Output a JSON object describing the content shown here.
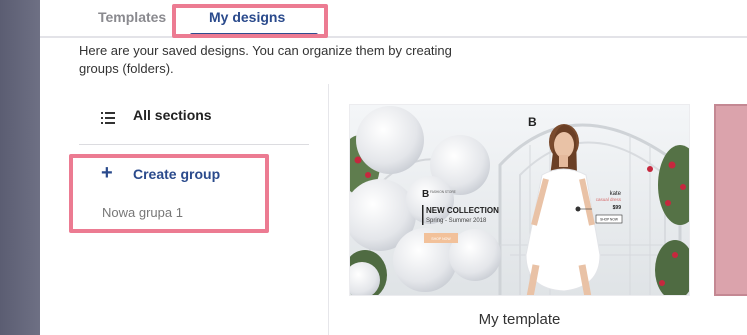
{
  "tabs": [
    {
      "label": "Templates"
    },
    {
      "label": "My designs"
    }
  ],
  "description": "Here are your saved designs. You can organize them by creating groups (folders).",
  "sidebar": {
    "all_sections_label": "All sections",
    "create_group_label": "Create group",
    "groups": [
      "Nowa grupa 1"
    ]
  },
  "design": {
    "caption": "My template",
    "preview": {
      "brand_letter": "B",
      "store_logo_text": "FASHION STORE",
      "headline": "NEW COLLECTION",
      "season": "Spring - Summer 2018",
      "left_button": "SHOP NOW",
      "product_name": "kate",
      "product_desc": "casual dress",
      "price": "$99",
      "right_button": "SHOP NOW"
    }
  },
  "colors": {
    "accent": "#2a4a8c",
    "highlight": "#ec7b92",
    "backdrop": "#62647a"
  },
  "icons": [
    "list-icon",
    "plus-icon"
  ]
}
